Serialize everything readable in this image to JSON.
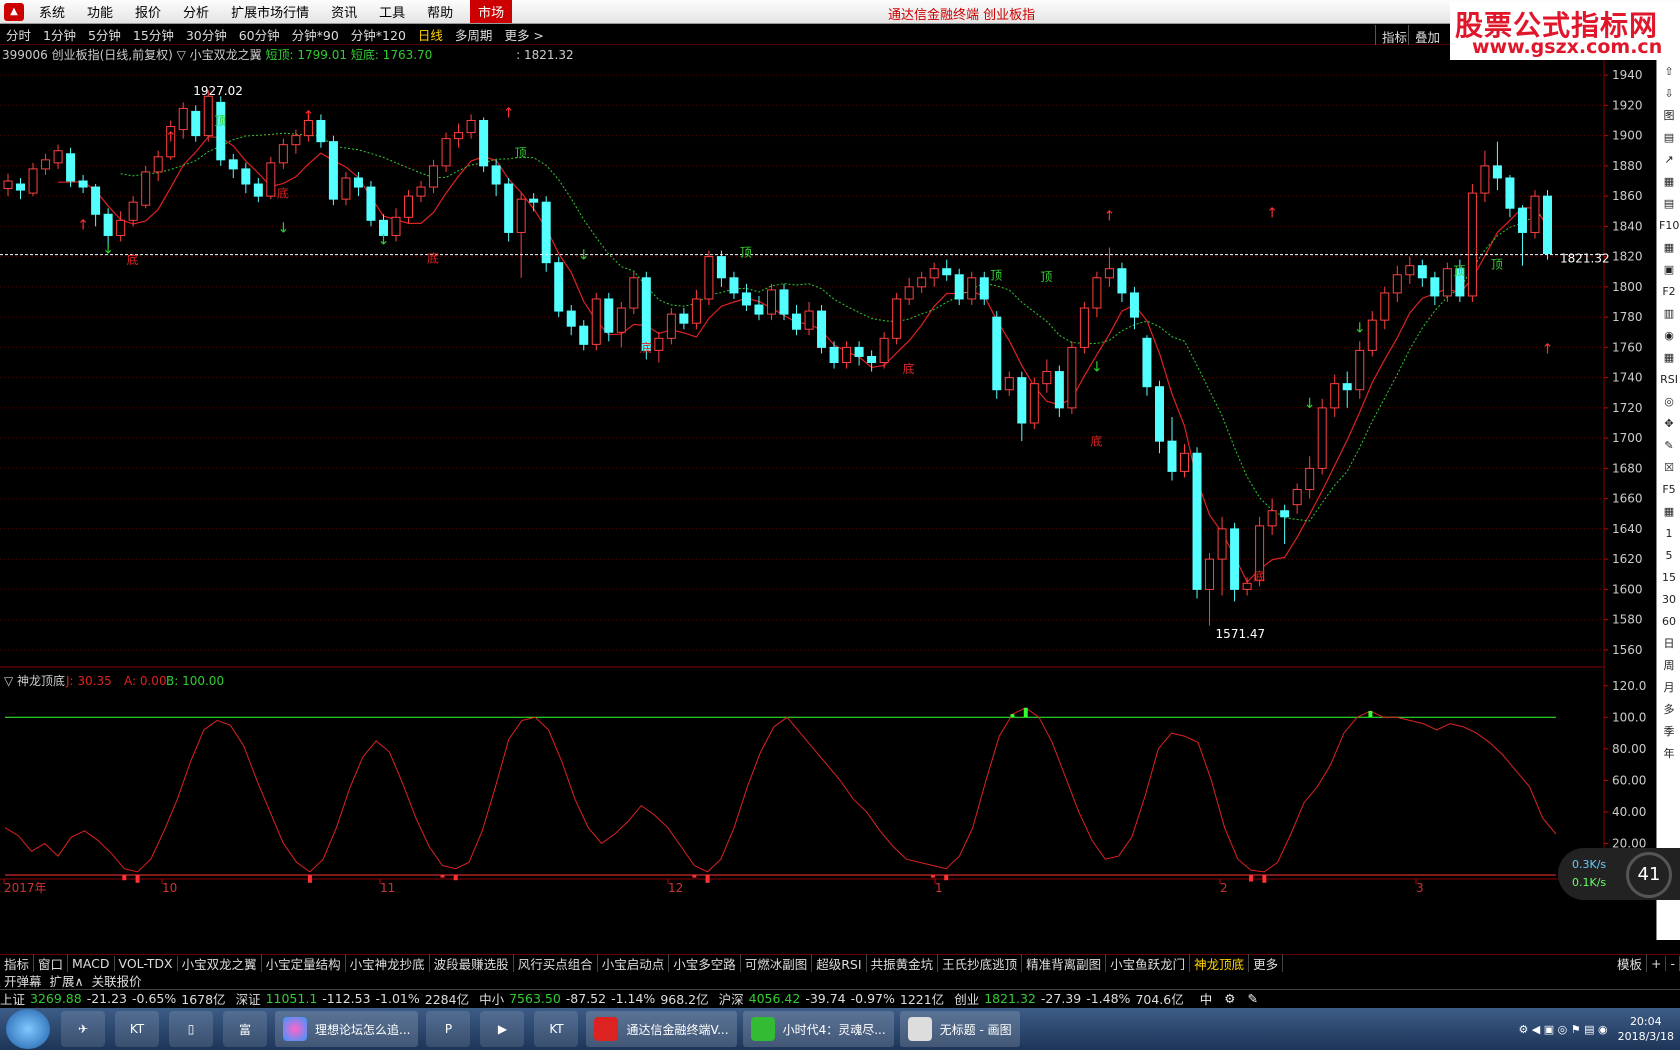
{
  "menubar": {
    "items": [
      "系统",
      "功能",
      "报价",
      "分析",
      "扩展市场行情",
      "资讯",
      "工具",
      "帮助"
    ],
    "market": "市场",
    "title": "通达信金融终端 创业板指"
  },
  "watermark": {
    "line1": "股票公式指标网",
    "line2": "www.gszx.com.cn"
  },
  "period_bar": {
    "items": [
      "分时",
      "1分钟",
      "5分钟",
      "15分钟",
      "30分钟",
      "60分钟",
      "分钟*90",
      "分钟*120"
    ],
    "active": "日线",
    "multi": "多周期",
    "more": "更多 >",
    "right_buttons": [
      "指标",
      "叠加"
    ]
  },
  "info_row": {
    "code_name": "399006 创业板指(日线,前复权)",
    "indicator": "▽ 小宝双龙之翼",
    "short_top": "短顶: 1799.01",
    "short_bottom": "短底: 1763.70",
    "cursor_price": ": 1821.32"
  },
  "chart_data": {
    "type": "candlestick",
    "y_axis_ticks": [
      "1940",
      "1920",
      "1900",
      "1880",
      "1860",
      "1840",
      "1820",
      "1800",
      "1780",
      "1760",
      "1740",
      "1720",
      "1700",
      "1680",
      "1660",
      "1640",
      "1620",
      "1600",
      "1580",
      "1560"
    ],
    "ylim": [
      1550,
      1950
    ],
    "last_price_label": "1821.32",
    "annotations": {
      "high": "1927.02",
      "low": "1571.47",
      "top": "顶",
      "bottom": "底"
    },
    "x_labels": [
      "2017年",
      "10",
      "11",
      "12",
      "1",
      "2",
      "3"
    ],
    "candles": [
      [
        1865,
        1870,
        1860,
        1875
      ],
      [
        1868,
        1864,
        1858,
        1872
      ],
      [
        1862,
        1878,
        1860,
        1882
      ],
      [
        1878,
        1884,
        1874,
        1888
      ],
      [
        1882,
        1890,
        1878,
        1894
      ],
      [
        1888,
        1870,
        1866,
        1892
      ],
      [
        1870,
        1866,
        1862,
        1874
      ],
      [
        1866,
        1848,
        1840,
        1868
      ],
      [
        1848,
        1834,
        1826,
        1852
      ],
      [
        1834,
        1844,
        1830,
        1850
      ],
      [
        1844,
        1856,
        1840,
        1860
      ],
      [
        1854,
        1876,
        1852,
        1880
      ],
      [
        1876,
        1886,
        1870,
        1890
      ],
      [
        1886,
        1906,
        1884,
        1910
      ],
      [
        1904,
        1918,
        1898,
        1922
      ],
      [
        1916,
        1900,
        1896,
        1920
      ],
      [
        1900,
        1926,
        1896,
        1930
      ],
      [
        1922,
        1884,
        1880,
        1926
      ],
      [
        1884,
        1878,
        1872,
        1888
      ],
      [
        1878,
        1868,
        1862,
        1882
      ],
      [
        1868,
        1860,
        1856,
        1872
      ],
      [
        1860,
        1882,
        1858,
        1886
      ],
      [
        1882,
        1894,
        1878,
        1898
      ],
      [
        1894,
        1900,
        1888,
        1904
      ],
      [
        1900,
        1910,
        1896,
        1916
      ],
      [
        1910,
        1896,
        1892,
        1914
      ],
      [
        1896,
        1858,
        1854,
        1900
      ],
      [
        1858,
        1872,
        1854,
        1876
      ],
      [
        1872,
        1866,
        1860,
        1876
      ],
      [
        1866,
        1844,
        1840,
        1870
      ],
      [
        1844,
        1834,
        1828,
        1848
      ],
      [
        1834,
        1846,
        1830,
        1852
      ],
      [
        1846,
        1860,
        1842,
        1864
      ],
      [
        1860,
        1866,
        1856,
        1870
      ],
      [
        1866,
        1880,
        1862,
        1884
      ],
      [
        1880,
        1898,
        1876,
        1902
      ],
      [
        1898,
        1902,
        1892,
        1908
      ],
      [
        1902,
        1910,
        1898,
        1914
      ],
      [
        1910,
        1880,
        1876,
        1912
      ],
      [
        1880,
        1868,
        1860,
        1884
      ],
      [
        1868,
        1836,
        1830,
        1872
      ],
      [
        1836,
        1858,
        1806,
        1862
      ],
      [
        1858,
        1856,
        1850,
        1862
      ],
      [
        1856,
        1816,
        1810,
        1860
      ],
      [
        1816,
        1784,
        1780,
        1820
      ],
      [
        1784,
        1774,
        1768,
        1788
      ],
      [
        1774,
        1762,
        1758,
        1778
      ],
      [
        1762,
        1792,
        1758,
        1796
      ],
      [
        1792,
        1770,
        1764,
        1796
      ],
      [
        1770,
        1786,
        1760,
        1790
      ],
      [
        1786,
        1806,
        1782,
        1810
      ],
      [
        1806,
        1758,
        1752,
        1810
      ],
      [
        1758,
        1766,
        1750,
        1770
      ],
      [
        1766,
        1782,
        1762,
        1786
      ],
      [
        1782,
        1776,
        1772,
        1786
      ],
      [
        1776,
        1792,
        1772,
        1798
      ],
      [
        1792,
        1820,
        1788,
        1824
      ],
      [
        1820,
        1806,
        1800,
        1824
      ],
      [
        1806,
        1796,
        1792,
        1810
      ],
      [
        1796,
        1788,
        1784,
        1802
      ],
      [
        1788,
        1782,
        1778,
        1794
      ],
      [
        1782,
        1798,
        1778,
        1802
      ],
      [
        1798,
        1782,
        1778,
        1802
      ],
      [
        1782,
        1772,
        1768,
        1788
      ],
      [
        1772,
        1784,
        1768,
        1790
      ],
      [
        1784,
        1760,
        1756,
        1788
      ],
      [
        1760,
        1750,
        1746,
        1764
      ],
      [
        1750,
        1760,
        1746,
        1764
      ],
      [
        1760,
        1754,
        1748,
        1764
      ],
      [
        1754,
        1750,
        1744,
        1758
      ],
      [
        1750,
        1766,
        1746,
        1770
      ],
      [
        1766,
        1792,
        1762,
        1796
      ],
      [
        1792,
        1800,
        1788,
        1806
      ],
      [
        1800,
        1806,
        1796,
        1810
      ],
      [
        1806,
        1812,
        1800,
        1816
      ],
      [
        1812,
        1808,
        1804,
        1818
      ],
      [
        1808,
        1792,
        1788,
        1812
      ],
      [
        1792,
        1806,
        1788,
        1810
      ],
      [
        1806,
        1792,
        1788,
        1810
      ],
      [
        1780,
        1732,
        1726,
        1784
      ],
      [
        1732,
        1740,
        1728,
        1744
      ],
      [
        1740,
        1710,
        1698,
        1744
      ],
      [
        1710,
        1736,
        1706,
        1740
      ],
      [
        1736,
        1744,
        1730,
        1752
      ],
      [
        1744,
        1720,
        1714,
        1748
      ],
      [
        1720,
        1760,
        1716,
        1764
      ],
      [
        1760,
        1786,
        1756,
        1790
      ],
      [
        1786,
        1806,
        1780,
        1810
      ],
      [
        1806,
        1812,
        1800,
        1826
      ],
      [
        1812,
        1796,
        1790,
        1816
      ],
      [
        1796,
        1780,
        1772,
        1800
      ],
      [
        1766,
        1734,
        1728,
        1768
      ],
      [
        1734,
        1698,
        1690,
        1738
      ],
      [
        1698,
        1678,
        1672,
        1714
      ],
      [
        1678,
        1690,
        1674,
        1696
      ],
      [
        1690,
        1600,
        1594,
        1694
      ],
      [
        1600,
        1620,
        1576,
        1624
      ],
      [
        1620,
        1640,
        1596,
        1648
      ],
      [
        1640,
        1600,
        1592,
        1644
      ],
      [
        1600,
        1604,
        1596,
        1608
      ],
      [
        1606,
        1642,
        1602,
        1648
      ],
      [
        1642,
        1652,
        1636,
        1660
      ],
      [
        1652,
        1648,
        1630,
        1656
      ],
      [
        1656,
        1666,
        1650,
        1670
      ],
      [
        1666,
        1680,
        1660,
        1688
      ],
      [
        1680,
        1720,
        1676,
        1726
      ],
      [
        1720,
        1736,
        1714,
        1742
      ],
      [
        1736,
        1732,
        1720,
        1744
      ],
      [
        1732,
        1758,
        1726,
        1764
      ],
      [
        1758,
        1778,
        1754,
        1784
      ],
      [
        1778,
        1796,
        1772,
        1800
      ],
      [
        1796,
        1808,
        1790,
        1814
      ],
      [
        1808,
        1814,
        1802,
        1820
      ],
      [
        1814,
        1806,
        1800,
        1818
      ],
      [
        1806,
        1794,
        1788,
        1810
      ],
      [
        1794,
        1812,
        1790,
        1816
      ],
      [
        1812,
        1794,
        1790,
        1818
      ],
      [
        1794,
        1862,
        1790,
        1868
      ],
      [
        1862,
        1880,
        1856,
        1890
      ],
      [
        1880,
        1872,
        1864,
        1896
      ],
      [
        1872,
        1852,
        1846,
        1874
      ],
      [
        1852,
        1836,
        1814,
        1854
      ],
      [
        1836,
        1860,
        1832,
        1864
      ],
      [
        1860,
        1822,
        1818,
        1864
      ]
    ],
    "sub_indicator": {
      "name": "▽ 神龙顶底",
      "j": "J: 30.35",
      "a": "A: 0.00",
      "b": "B: 100.00",
      "y_ticks": [
        "120.0",
        "100.0",
        "80.00",
        "60.00",
        "40.00",
        "20.00"
      ],
      "ylim": [
        0,
        130
      ],
      "j_series": [
        30,
        25,
        15,
        20,
        12,
        24,
        28,
        22,
        14,
        4,
        2,
        10,
        28,
        48,
        72,
        92,
        98,
        95,
        82,
        60,
        40,
        20,
        8,
        2,
        10,
        30,
        55,
        75,
        85,
        78,
        58,
        36,
        18,
        6,
        4,
        8,
        28,
        56,
        86,
        98,
        100,
        92,
        72,
        48,
        30,
        20,
        26,
        34,
        44,
        38,
        30,
        18,
        6,
        2,
        10,
        30,
        56,
        78,
        94,
        100,
        90,
        80,
        70,
        60,
        48,
        40,
        28,
        18,
        10,
        8,
        6,
        4,
        12,
        30,
        60,
        88,
        102,
        106,
        100,
        84,
        62,
        40,
        22,
        10,
        12,
        24,
        50,
        80,
        90,
        88,
        84,
        60,
        30,
        10,
        3,
        2,
        8,
        26,
        46,
        56,
        70,
        90,
        100,
        104,
        100,
        100,
        98,
        96,
        92,
        96,
        94,
        90,
        84,
        76,
        66,
        56,
        36,
        26
      ]
    }
  },
  "tabs_primary": [
    "指标",
    "窗口",
    "MACD",
    "VOL-TDX",
    "小宝双龙之翼",
    "小宝定量结构",
    "小宝神龙抄底",
    "波段最赚选股",
    "风行买点组合",
    "小宝启动点",
    "小宝多空路",
    "可燃冰副图",
    "超级RSI",
    "共振黄金坑",
    "王氏抄底逃顶",
    "精准背离副图",
    "小宝鱼跃龙门",
    "神龙顶底",
    "更多"
  ],
  "tabs_active": "神龙顶底",
  "tabs_secondary": [
    "开弹幕",
    "扩展∧",
    "关联报价"
  ],
  "tabs_right": [
    "模板",
    "+",
    "-"
  ],
  "quotes": [
    {
      "label": "上证",
      "value": "3269.88",
      "chg": "-21.23",
      "pct": "-0.65%",
      "amt": "1678亿"
    },
    {
      "label": "深证",
      "value": "11051.1",
      "chg": "-112.53",
      "pct": "-1.01%",
      "amt": "2284亿"
    },
    {
      "label": "中小",
      "value": "7563.50",
      "chg": "-87.52",
      "pct": "-1.14%",
      "amt": "968.2亿"
    },
    {
      "label": "沪深",
      "value": "4056.42",
      "chg": "-39.74",
      "pct": "-0.97%",
      "amt": "1221亿"
    },
    {
      "label": "创业",
      "value": "1821.32",
      "chg": "-27.39",
      "pct": "-1.48%",
      "amt": "704.6亿"
    }
  ],
  "quote_extra": [
    "中",
    "⚙",
    "✎"
  ],
  "netmon": {
    "up": "0.3K/s",
    "down": "0.1K/s",
    "pct": "41"
  },
  "side_tools": [
    "⇧",
    "⇩",
    "图",
    "▤",
    "↗",
    "▦",
    "▤",
    "F10",
    "▦",
    "▣",
    "F2",
    "▥",
    "◉",
    "▦",
    "RSI",
    "◎",
    "✥",
    "✎",
    "☒",
    "F5",
    "▦",
    "1",
    "5",
    "15",
    "30",
    "60",
    "日",
    "周",
    "月",
    "多",
    "季",
    "年"
  ],
  "taskbar": {
    "apps": [
      "理想论坛怎么追...",
      "通达信金融终端V...",
      "小时代4：灵魂尽...",
      "无标题 - 画图"
    ],
    "clock_time": "20:04",
    "clock_date": "2018/3/18"
  }
}
